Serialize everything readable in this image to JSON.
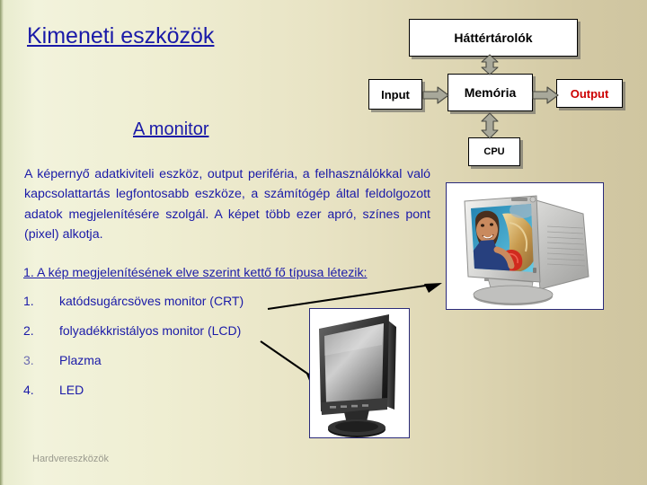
{
  "slide": {
    "heading_main": "Kimeneti eszközök",
    "heading_sub": "A monitor",
    "paragraph": "A képernyő adatkiviteli eszköz, output periféria, a felhasználókkal való kapcsolattartás legfontosabb eszköze, a számítógép által feldolgozott adatok megjelenítésére szolgál. A képet több ezer apró, színes pont (pixel) alkotja.",
    "subheading": "1. A kép megjelenítésének elve szerint kettő fő típusa létezik:",
    "footer": "Hardvereszközök"
  },
  "list": {
    "items": [
      {
        "num": "1.",
        "text": "katódsugárcsöves monitor (CRT)"
      },
      {
        "num": "2.",
        "text": "folyadékkristályos monitor (LCD)"
      },
      {
        "num": "3.",
        "text": "Plazma"
      },
      {
        "num": "4.",
        "text": "LED"
      }
    ]
  },
  "diagram": {
    "storage": "Háttértárolók",
    "input": "Input",
    "memory": "Memória",
    "output": "Output",
    "cpu": "CPU",
    "arrow_storage_memory": "double-arrow-vertical-icon",
    "arrow_memory_cpu": "double-arrow-vertical-icon",
    "arrow_input_memory": "arrow-right-icon",
    "arrow_memory_output": "arrow-right-icon"
  },
  "pictures": {
    "crt": "crt-monitor-photo",
    "lcd": "lcd-monitor-photo",
    "pointer_crt": "pointer-arrow-to-crt-icon",
    "pointer_lcd": "pointer-arrow-to-lcd-icon"
  },
  "colors": {
    "text_blue": "#1a1aa8",
    "output_red": "#cc0000",
    "footer_gray": "#9a9a8e",
    "frame_blue": "#2a2a7a"
  }
}
